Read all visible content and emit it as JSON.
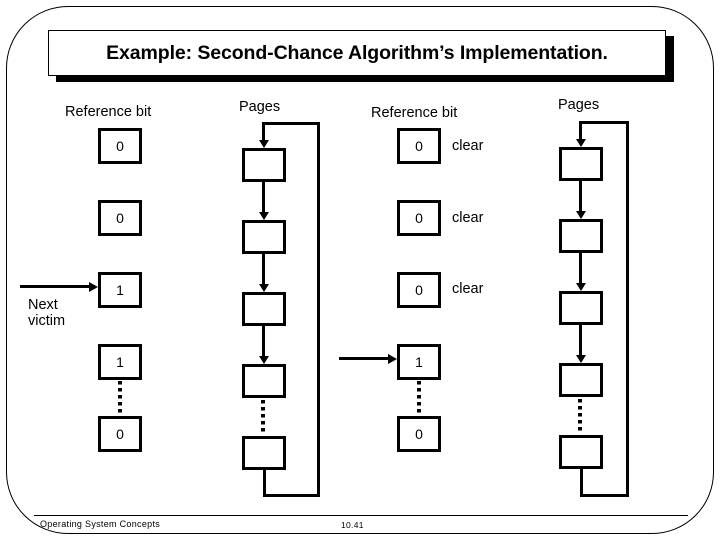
{
  "slide": {
    "title": "Example: Second-Chance Algorithm’s Implementation.",
    "footer_left": "Operating System Concepts",
    "footer_center": "10.41"
  },
  "left_diagram": {
    "reference_bit_heading": "Reference bit",
    "pages_heading": "Pages",
    "pointer_label_line1": "Next",
    "pointer_label_line2": "victim",
    "pointer_target_index": 2,
    "reference_bits": [
      "0",
      "0",
      "1",
      "1",
      "0"
    ],
    "page_count": 5,
    "ellipsis_after_index": 3
  },
  "right_diagram": {
    "reference_bit_heading": "Reference bit",
    "pages_heading": "Pages",
    "pointer_target_index": 3,
    "reference_bits": [
      "0",
      "0",
      "0",
      "1",
      "0"
    ],
    "clear_labels": [
      "clear",
      "clear",
      "clear",
      "",
      ""
    ],
    "page_count": 5,
    "ellipsis_after_index": 3
  },
  "colors": {
    "ink": "#000000",
    "paper": "#ffffff"
  }
}
